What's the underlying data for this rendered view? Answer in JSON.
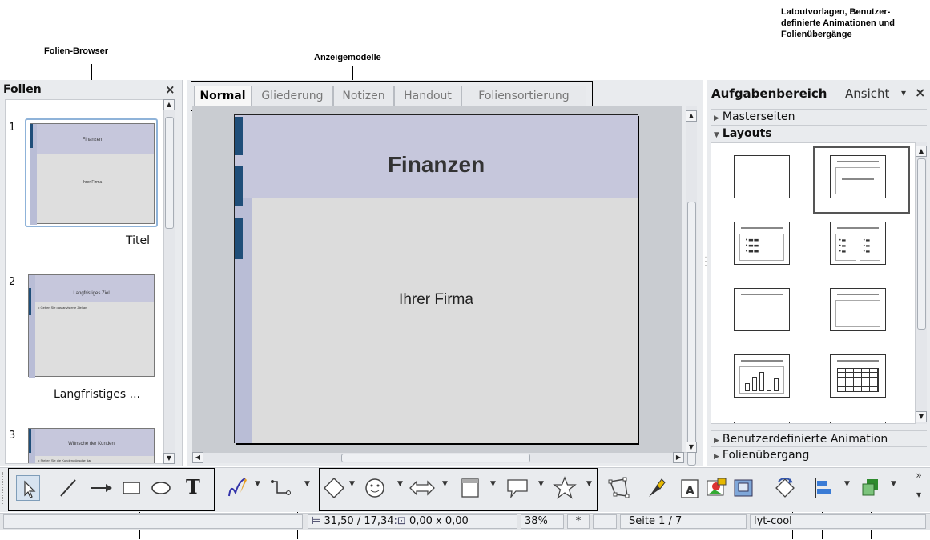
{
  "callouts": {
    "slide_browser": "Folien-Browser",
    "view_modes": "Anzeigemodelle",
    "task_pane": [
      "Latoutvorlagen, Benutzer-",
      "definierte Animationen und",
      "Folienübergänge"
    ]
  },
  "slides_panel": {
    "title": "Folien",
    "close": "×",
    "slides": [
      {
        "number": "1",
        "title": "Finanzen",
        "body": "Ihrer Firma",
        "caption": "Titel"
      },
      {
        "number": "2",
        "title": "Langfristiges Ziel",
        "body": "• Geben Sie das anvisierte Ziel an",
        "caption": "Langfristiges ..."
      },
      {
        "number": "3",
        "title": "Wünsche der Kunden",
        "body": "• Stellen Sie die Kundenwünsche dar",
        "caption": ""
      }
    ]
  },
  "view_tabs": [
    "Normal",
    "Gliederung",
    "Notizen",
    "Handout",
    "Foliensortierung"
  ],
  "slide": {
    "title": "Finanzen",
    "subtitle": "Ihrer Firma"
  },
  "task_pane": {
    "title": "Aufgabenbereich",
    "view_menu": "Ansicht",
    "menu_arrow": "▾",
    "close": "×",
    "sections": {
      "master_pages": "Masterseiten",
      "layouts": "Layouts",
      "custom_animation": "Benutzerdefinierte Animation",
      "slide_transition": "Folienübergang"
    }
  },
  "status_bar": {
    "position": "31,50 / 17,34",
    "size": "0,00 x 0,00",
    "zoom": "38%",
    "modified": "*",
    "page": "Seite 1 / 7",
    "design": "lyt-cool"
  },
  "toolbar_icons": [
    "select-icon",
    "line-icon",
    "arrow-line-icon",
    "rectangle-icon",
    "ellipse-icon",
    "text-icon",
    "curve-icon",
    "connector-icon",
    "basic-shapes-icon",
    "symbol-shapes-icon",
    "block-arrows-icon",
    "flowchart-icon",
    "callouts-icon",
    "stars-icon",
    "points-icon",
    "glue-points-icon",
    "fontwork-icon",
    "insert-image-icon",
    "insert-object-icon",
    "rotate-icon",
    "align-icon",
    "arrange-icon",
    "more-icon"
  ]
}
